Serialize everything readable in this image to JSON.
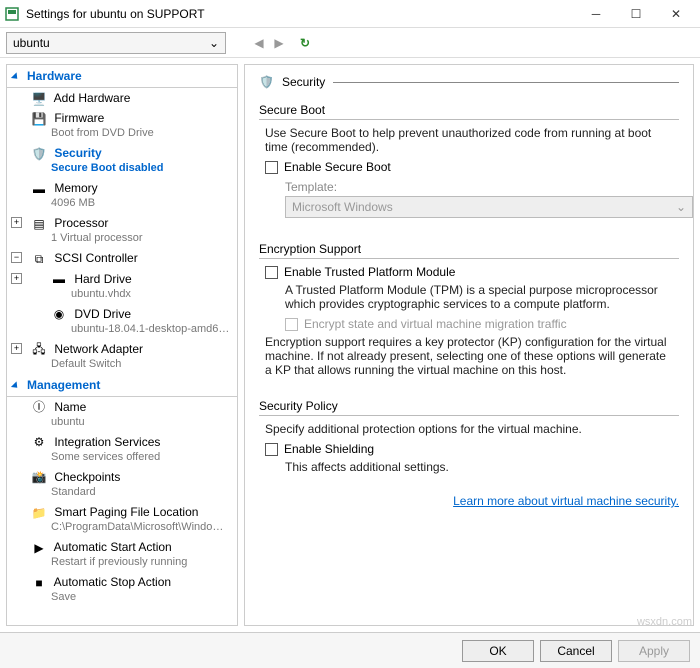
{
  "window": {
    "title": "Settings for ubuntu on SUPPORT"
  },
  "toolbar": {
    "vm_name": "ubuntu"
  },
  "sections": {
    "hardware": "Hardware",
    "management": "Management"
  },
  "tree": {
    "add_hardware": "Add Hardware",
    "firmware": {
      "label": "Firmware",
      "sub": "Boot from DVD Drive"
    },
    "security": {
      "label": "Security",
      "sub": "Secure Boot disabled"
    },
    "memory": {
      "label": "Memory",
      "sub": "4096 MB"
    },
    "processor": {
      "label": "Processor",
      "sub": "1 Virtual processor"
    },
    "scsi": {
      "label": "SCSI Controller"
    },
    "hard_drive": {
      "label": "Hard Drive",
      "sub": "ubuntu.vhdx"
    },
    "dvd_drive": {
      "label": "DVD Drive",
      "sub": "ubuntu-18.04.1-desktop-amd6…"
    },
    "net_adapter": {
      "label": "Network Adapter",
      "sub": "Default Switch"
    },
    "name": {
      "label": "Name",
      "sub": "ubuntu"
    },
    "integration": {
      "label": "Integration Services",
      "sub": "Some services offered"
    },
    "checkpoints": {
      "label": "Checkpoints",
      "sub": "Standard"
    },
    "paging": {
      "label": "Smart Paging File Location",
      "sub": "C:\\ProgramData\\Microsoft\\Windo…"
    },
    "autostart": {
      "label": "Automatic Start Action",
      "sub": "Restart if previously running"
    },
    "autostop": {
      "label": "Automatic Stop Action",
      "sub": "Save"
    }
  },
  "panel": {
    "title": "Security",
    "secure_boot": {
      "group": "Secure Boot",
      "desc": "Use Secure Boot to help prevent unauthorized code from running at boot time (recommended).",
      "enable": "Enable Secure Boot",
      "template_label": "Template:",
      "template_value": "Microsoft Windows"
    },
    "encryption": {
      "group": "Encryption Support",
      "tpm": "Enable Trusted Platform Module",
      "tpm_desc": "A Trusted Platform Module (TPM) is a special purpose microprocessor which provides cryptographic services to a compute platform.",
      "encrypt_state": "Encrypt state and virtual machine migration traffic",
      "kp_desc": "Encryption support requires a key protector (KP) configuration for the virtual machine. If not already present, selecting one of these options will generate a KP that allows running the virtual machine on this host."
    },
    "policy": {
      "group": "Security Policy",
      "desc": "Specify additional protection options for the virtual machine.",
      "shielding": "Enable Shielding",
      "affects": "This affects additional settings."
    },
    "link": "Learn more about virtual machine security."
  },
  "footer": {
    "ok": "OK",
    "cancel": "Cancel",
    "apply": "Apply"
  },
  "watermark": "wsxdn.com"
}
